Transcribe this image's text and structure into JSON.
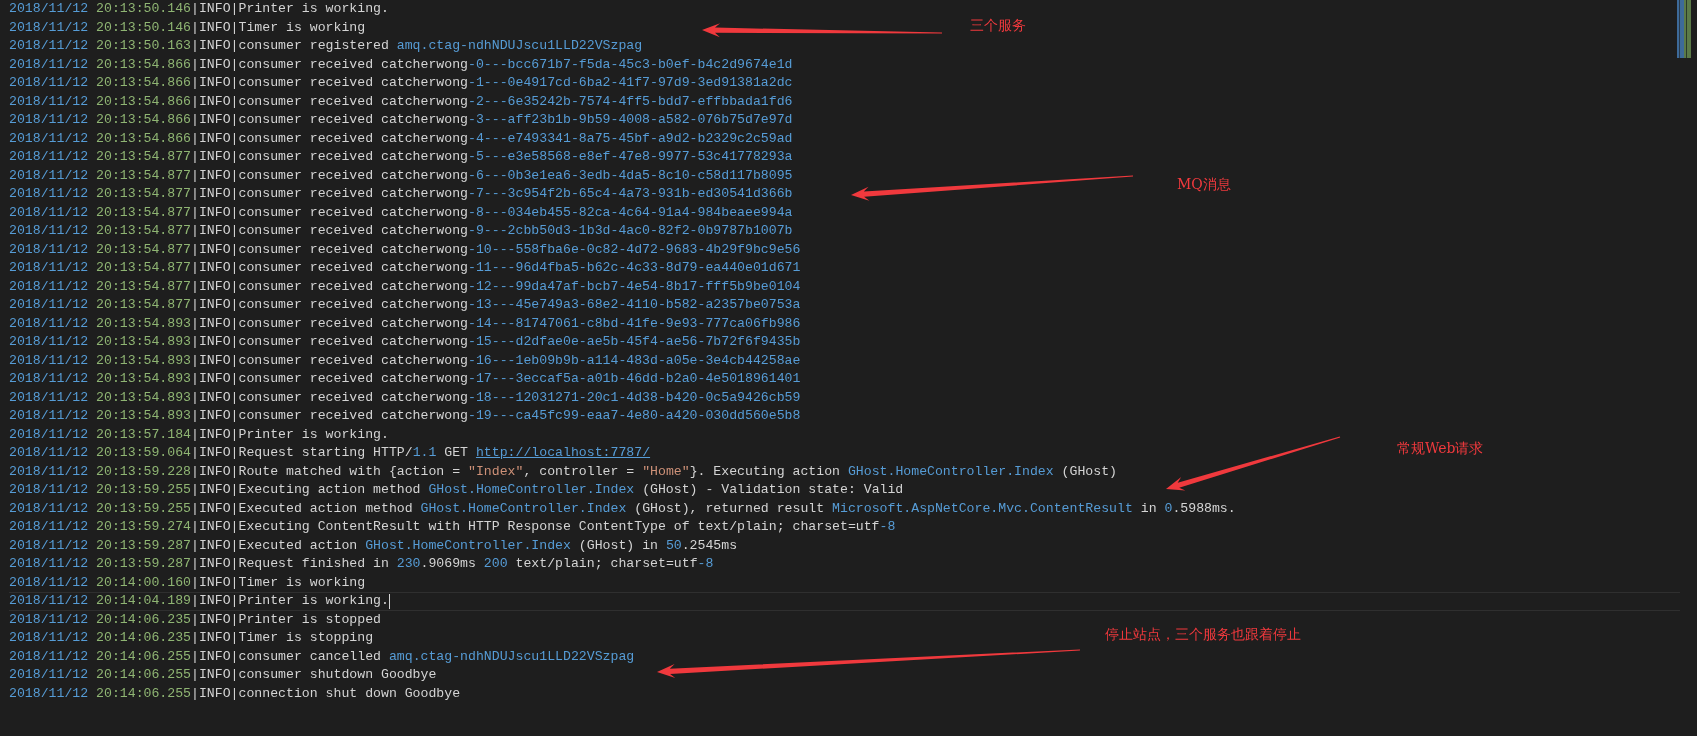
{
  "log_lines": [
    {
      "date": "2018/11/12",
      "time": "20:13:50.146",
      "level": "|INFO|",
      "current": false,
      "message": [
        {
          "kind": "plain",
          "text": "Printer is working."
        }
      ]
    },
    {
      "date": "2018/11/12",
      "time": "20:13:50.146",
      "level": "|INFO|",
      "current": false,
      "message": [
        {
          "kind": "plain",
          "text": "Timer is working"
        }
      ]
    },
    {
      "date": "2018/11/12",
      "time": "20:13:50.163",
      "level": "|INFO|",
      "current": false,
      "message": [
        {
          "kind": "plain",
          "text": "consumer registered "
        },
        {
          "kind": "value",
          "text": "amq.ctag-ndhNDUJscu1LLD22VSzpag"
        }
      ]
    },
    {
      "date": "2018/11/12",
      "time": "20:13:54.866",
      "level": "|INFO|",
      "current": false,
      "message": [
        {
          "kind": "plain",
          "text": "consumer received catcherwong"
        },
        {
          "kind": "value",
          "text": "-0---bcc671b7-f5da-45c3-b0ef-b4c2d9674e1d"
        }
      ]
    },
    {
      "date": "2018/11/12",
      "time": "20:13:54.866",
      "level": "|INFO|",
      "current": false,
      "message": [
        {
          "kind": "plain",
          "text": "consumer received catcherwong"
        },
        {
          "kind": "value",
          "text": "-1---0e4917cd-6ba2-41f7-97d9-3ed91381a2dc"
        }
      ]
    },
    {
      "date": "2018/11/12",
      "time": "20:13:54.866",
      "level": "|INFO|",
      "current": false,
      "message": [
        {
          "kind": "plain",
          "text": "consumer received catcherwong"
        },
        {
          "kind": "value",
          "text": "-2---6e35242b-7574-4ff5-bdd7-effbbada1fd6"
        }
      ]
    },
    {
      "date": "2018/11/12",
      "time": "20:13:54.866",
      "level": "|INFO|",
      "current": false,
      "message": [
        {
          "kind": "plain",
          "text": "consumer received catcherwong"
        },
        {
          "kind": "value",
          "text": "-3---aff23b1b-9b59-4008-a582-076b75d7e97d"
        }
      ]
    },
    {
      "date": "2018/11/12",
      "time": "20:13:54.866",
      "level": "|INFO|",
      "current": false,
      "message": [
        {
          "kind": "plain",
          "text": "consumer received catcherwong"
        },
        {
          "kind": "value",
          "text": "-4---e7493341-8a75-45bf-a9d2-b2329c2c59ad"
        }
      ]
    },
    {
      "date": "2018/11/12",
      "time": "20:13:54.877",
      "level": "|INFO|",
      "current": false,
      "message": [
        {
          "kind": "plain",
          "text": "consumer received catcherwong"
        },
        {
          "kind": "value",
          "text": "-5---e3e58568-e8ef-47e8-9977-53c41778293a"
        }
      ]
    },
    {
      "date": "2018/11/12",
      "time": "20:13:54.877",
      "level": "|INFO|",
      "current": false,
      "message": [
        {
          "kind": "plain",
          "text": "consumer received catcherwong"
        },
        {
          "kind": "value",
          "text": "-6---0b3e1ea6-3edb-4da5-8c10-c58d117b8095"
        }
      ]
    },
    {
      "date": "2018/11/12",
      "time": "20:13:54.877",
      "level": "|INFO|",
      "current": false,
      "message": [
        {
          "kind": "plain",
          "text": "consumer received catcherwong"
        },
        {
          "kind": "value",
          "text": "-7---3c954f2b-65c4-4a73-931b-ed30541d366b"
        }
      ]
    },
    {
      "date": "2018/11/12",
      "time": "20:13:54.877",
      "level": "|INFO|",
      "current": false,
      "message": [
        {
          "kind": "plain",
          "text": "consumer received catcherwong"
        },
        {
          "kind": "value",
          "text": "-8---034eb455-82ca-4c64-91a4-984beaee994a"
        }
      ]
    },
    {
      "date": "2018/11/12",
      "time": "20:13:54.877",
      "level": "|INFO|",
      "current": false,
      "message": [
        {
          "kind": "plain",
          "text": "consumer received catcherwong"
        },
        {
          "kind": "value",
          "text": "-9---2cbb50d3-1b3d-4ac0-82f2-0b9787b1007b"
        }
      ]
    },
    {
      "date": "2018/11/12",
      "time": "20:13:54.877",
      "level": "|INFO|",
      "current": false,
      "message": [
        {
          "kind": "plain",
          "text": "consumer received catcherwong"
        },
        {
          "kind": "value",
          "text": "-10---558fba6e-0c82-4d72-9683-4b29f9bc9e56"
        }
      ]
    },
    {
      "date": "2018/11/12",
      "time": "20:13:54.877",
      "level": "|INFO|",
      "current": false,
      "message": [
        {
          "kind": "plain",
          "text": "consumer received catcherwong"
        },
        {
          "kind": "value",
          "text": "-11---96d4fba5-b62c-4c33-8d79-ea440e01d671"
        }
      ]
    },
    {
      "date": "2018/11/12",
      "time": "20:13:54.877",
      "level": "|INFO|",
      "current": false,
      "message": [
        {
          "kind": "plain",
          "text": "consumer received catcherwong"
        },
        {
          "kind": "value",
          "text": "-12---99da47af-bcb7-4e54-8b17-fff5b9be0104"
        }
      ]
    },
    {
      "date": "2018/11/12",
      "time": "20:13:54.877",
      "level": "|INFO|",
      "current": false,
      "message": [
        {
          "kind": "plain",
          "text": "consumer received catcherwong"
        },
        {
          "kind": "value",
          "text": "-13---45e749a3-68e2-4110-b582-a2357be0753a"
        }
      ]
    },
    {
      "date": "2018/11/12",
      "time": "20:13:54.893",
      "level": "|INFO|",
      "current": false,
      "message": [
        {
          "kind": "plain",
          "text": "consumer received catcherwong"
        },
        {
          "kind": "value",
          "text": "-14---81747061-c8bd-41fe-9e93-777ca06fb986"
        }
      ]
    },
    {
      "date": "2018/11/12",
      "time": "20:13:54.893",
      "level": "|INFO|",
      "current": false,
      "message": [
        {
          "kind": "plain",
          "text": "consumer received catcherwong"
        },
        {
          "kind": "value",
          "text": "-15---d2dfae0e-ae5b-45f4-ae56-7b72f6f9435b"
        }
      ]
    },
    {
      "date": "2018/11/12",
      "time": "20:13:54.893",
      "level": "|INFO|",
      "current": false,
      "message": [
        {
          "kind": "plain",
          "text": "consumer received catcherwong"
        },
        {
          "kind": "value",
          "text": "-16---1eb09b9b-a114-483d-a05e-3e4cb44258ae"
        }
      ]
    },
    {
      "date": "2018/11/12",
      "time": "20:13:54.893",
      "level": "|INFO|",
      "current": false,
      "message": [
        {
          "kind": "plain",
          "text": "consumer received catcherwong"
        },
        {
          "kind": "value",
          "text": "-17---3eccaf5a-a01b-46dd-b2a0-4e5018961401"
        }
      ]
    },
    {
      "date": "2018/11/12",
      "time": "20:13:54.893",
      "level": "|INFO|",
      "current": false,
      "message": [
        {
          "kind": "plain",
          "text": "consumer received catcherwong"
        },
        {
          "kind": "value",
          "text": "-18---12031271-20c1-4d38-b420-0c5a9426cb59"
        }
      ]
    },
    {
      "date": "2018/11/12",
      "time": "20:13:54.893",
      "level": "|INFO|",
      "current": false,
      "message": [
        {
          "kind": "plain",
          "text": "consumer received catcherwong"
        },
        {
          "kind": "value",
          "text": "-19---ca45fc99-eaa7-4e80-a420-030dd560e5b8"
        }
      ]
    },
    {
      "date": "2018/11/12",
      "time": "20:13:57.184",
      "level": "|INFO|",
      "current": false,
      "message": [
        {
          "kind": "plain",
          "text": "Printer is working."
        }
      ]
    },
    {
      "date": "2018/11/12",
      "time": "20:13:59.064",
      "level": "|INFO|",
      "current": false,
      "message": [
        {
          "kind": "plain",
          "text": "Request starting HTTP/"
        },
        {
          "kind": "value",
          "text": "1.1"
        },
        {
          "kind": "plain",
          "text": " GET "
        },
        {
          "kind": "link",
          "text": "http://localhost:7787/"
        }
      ]
    },
    {
      "date": "2018/11/12",
      "time": "20:13:59.228",
      "level": "|INFO|",
      "current": false,
      "message": [
        {
          "kind": "plain",
          "text": "Route matched with {action = "
        },
        {
          "kind": "string",
          "text": "\"Index\""
        },
        {
          "kind": "plain",
          "text": ", controller = "
        },
        {
          "kind": "string",
          "text": "\"Home\""
        },
        {
          "kind": "plain",
          "text": "}. Executing action "
        },
        {
          "kind": "value",
          "text": "GHost.HomeController.Index"
        },
        {
          "kind": "plain",
          "text": " (GHost)"
        }
      ]
    },
    {
      "date": "2018/11/12",
      "time": "20:13:59.255",
      "level": "|INFO|",
      "current": false,
      "message": [
        {
          "kind": "plain",
          "text": "Executing action method "
        },
        {
          "kind": "value",
          "text": "GHost.HomeController.Index"
        },
        {
          "kind": "plain",
          "text": " (GHost) - Validation state: Valid"
        }
      ]
    },
    {
      "date": "2018/11/12",
      "time": "20:13:59.255",
      "level": "|INFO|",
      "current": false,
      "message": [
        {
          "kind": "plain",
          "text": "Executed action method "
        },
        {
          "kind": "value",
          "text": "GHost.HomeController.Index"
        },
        {
          "kind": "plain",
          "text": " (GHost), returned result "
        },
        {
          "kind": "value",
          "text": "Microsoft.AspNetCore.Mvc.ContentResult"
        },
        {
          "kind": "plain",
          "text": " in "
        },
        {
          "kind": "value",
          "text": "0"
        },
        {
          "kind": "plain",
          "text": ".5988ms."
        }
      ]
    },
    {
      "date": "2018/11/12",
      "time": "20:13:59.274",
      "level": "|INFO|",
      "current": false,
      "message": [
        {
          "kind": "plain",
          "text": "Executing ContentResult with HTTP Response ContentType of text/plain; charset=utf"
        },
        {
          "kind": "value",
          "text": "-8"
        }
      ]
    },
    {
      "date": "2018/11/12",
      "time": "20:13:59.287",
      "level": "|INFO|",
      "current": false,
      "message": [
        {
          "kind": "plain",
          "text": "Executed action "
        },
        {
          "kind": "value",
          "text": "GHost.HomeController.Index"
        },
        {
          "kind": "plain",
          "text": " (GHost) in "
        },
        {
          "kind": "value",
          "text": "50"
        },
        {
          "kind": "plain",
          "text": ".2545ms"
        }
      ]
    },
    {
      "date": "2018/11/12",
      "time": "20:13:59.287",
      "level": "|INFO|",
      "current": false,
      "message": [
        {
          "kind": "plain",
          "text": "Request finished in "
        },
        {
          "kind": "value",
          "text": "230"
        },
        {
          "kind": "plain",
          "text": ".9069ms "
        },
        {
          "kind": "value",
          "text": "200"
        },
        {
          "kind": "plain",
          "text": " text/plain; charset=utf"
        },
        {
          "kind": "value",
          "text": "-8"
        }
      ]
    },
    {
      "date": "2018/11/12",
      "time": "20:14:00.160",
      "level": "|INFO|",
      "current": false,
      "message": [
        {
          "kind": "plain",
          "text": "Timer is working"
        }
      ]
    },
    {
      "date": "2018/11/12",
      "time": "20:14:04.189",
      "level": "|INFO|",
      "current": true,
      "message": [
        {
          "kind": "plain",
          "text": "Printer is working."
        }
      ]
    },
    {
      "date": "2018/11/12",
      "time": "20:14:06.235",
      "level": "|INFO|",
      "current": false,
      "message": [
        {
          "kind": "plain",
          "text": "Printer is stopped"
        }
      ]
    },
    {
      "date": "2018/11/12",
      "time": "20:14:06.235",
      "level": "|INFO|",
      "current": false,
      "message": [
        {
          "kind": "plain",
          "text": "Timer is stopping"
        }
      ]
    },
    {
      "date": "2018/11/12",
      "time": "20:14:06.255",
      "level": "|INFO|",
      "current": false,
      "message": [
        {
          "kind": "plain",
          "text": "consumer cancelled "
        },
        {
          "kind": "value",
          "text": "amq.ctag-ndhNDUJscu1LLD22VSzpag"
        }
      ]
    },
    {
      "date": "2018/11/12",
      "time": "20:14:06.255",
      "level": "|INFO|",
      "current": false,
      "message": [
        {
          "kind": "plain",
          "text": "consumer shutdown Goodbye"
        }
      ]
    },
    {
      "date": "2018/11/12",
      "time": "20:14:06.255",
      "level": "|INFO|",
      "current": false,
      "message": [
        {
          "kind": "plain",
          "text": "connection shut down Goodbye"
        }
      ]
    }
  ],
  "annotations": [
    {
      "text": "三个服务"
    },
    {
      "text": "MQ消息"
    },
    {
      "text": "常规Web请求"
    },
    {
      "text": "停止站点，三个服务也跟着停止"
    }
  ]
}
